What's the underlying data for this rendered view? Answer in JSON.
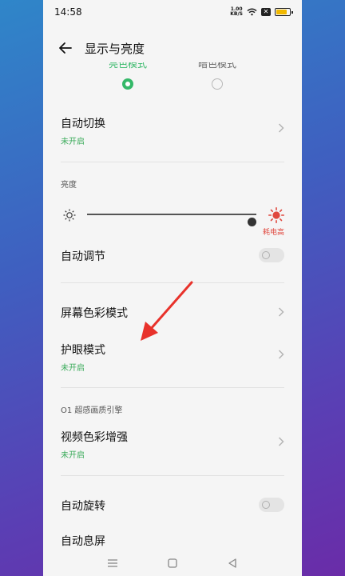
{
  "status": {
    "time": "14:58",
    "net_speed_top": "1.00",
    "net_speed_bottom": "KB/S",
    "battery_level": 0.85
  },
  "header": {
    "title": "显示与亮度"
  },
  "modes": [
    {
      "label": "亮色模式",
      "selected": true
    },
    {
      "label": "暗色模式",
      "selected": false
    }
  ],
  "auto_switch": {
    "title": "自动切换",
    "status": "未开启"
  },
  "brightness": {
    "section": "亮度",
    "level": 0.97,
    "power_note": "耗电高"
  },
  "auto_adjust": {
    "title": "自动调节",
    "enabled": false
  },
  "screen_color": {
    "title": "屏幕色彩模式"
  },
  "eye_care": {
    "title": "护眼模式",
    "status": "未开启"
  },
  "engine": {
    "section": "O1 超感画质引擎"
  },
  "video_color": {
    "title": "视频色彩增强",
    "status": "未开启"
  },
  "auto_rotate": {
    "title": "自动旋转",
    "enabled": false
  },
  "auto_sleep": {
    "title": "自动息屏"
  },
  "colors": {
    "accent_green": "#34b868",
    "status_green": "#3aab5a",
    "warning_red": "#e0483e",
    "annotation_arrow": "#e8322b"
  }
}
